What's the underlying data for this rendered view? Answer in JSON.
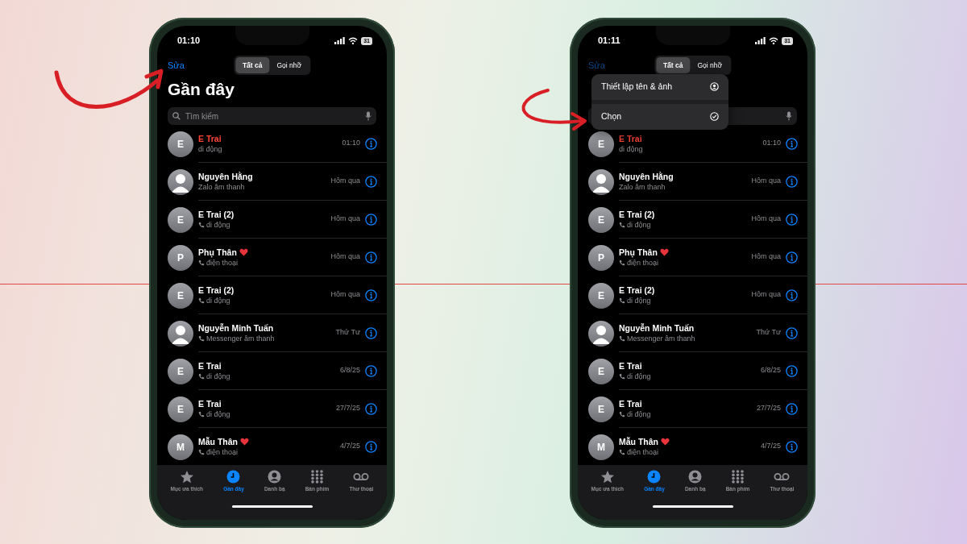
{
  "phones": [
    {
      "status_time": "01:10",
      "battery": "31",
      "edit_label": "Sửa",
      "edit_dimmed": false,
      "segments": [
        {
          "label": "Tất cả",
          "selected": true
        },
        {
          "label": "Gọi nhỡ",
          "selected": false
        }
      ],
      "title": "Gần đây",
      "search_placeholder": "Tìm kiếm",
      "calls": [
        {
          "name": "E Trai",
          "missed": true,
          "kind": "letter",
          "initial": "E",
          "favorite": false,
          "phone_icon": false,
          "detail": "di động",
          "time": "01:10"
        },
        {
          "name": "Nguyên Hằng",
          "missed": false,
          "kind": "silhouette",
          "favorite": false,
          "phone_icon": false,
          "detail": "Zalo âm thanh",
          "time": "Hôm qua"
        },
        {
          "name": "E Trai (2)",
          "missed": false,
          "kind": "letter",
          "initial": "E",
          "favorite": false,
          "phone_icon": true,
          "detail": "di động",
          "time": "Hôm qua"
        },
        {
          "name": "Phụ Thân",
          "missed": false,
          "kind": "letter",
          "initial": "P",
          "favorite": true,
          "phone_icon": true,
          "detail": "điện thoại",
          "time": "Hôm qua"
        },
        {
          "name": "E Trai (2)",
          "missed": false,
          "kind": "letter",
          "initial": "E",
          "favorite": false,
          "phone_icon": true,
          "detail": "di động",
          "time": "Hôm qua"
        },
        {
          "name": "Nguyễn Minh Tuấn",
          "missed": false,
          "kind": "silhouette",
          "favorite": false,
          "phone_icon": true,
          "detail": "Messenger âm thanh",
          "time": "Thứ Tư"
        },
        {
          "name": "E Trai",
          "missed": false,
          "kind": "letter",
          "initial": "E",
          "favorite": false,
          "phone_icon": true,
          "detail": "di động",
          "time": "6/8/25"
        },
        {
          "name": "E Trai",
          "missed": false,
          "kind": "letter",
          "initial": "E",
          "favorite": false,
          "phone_icon": true,
          "detail": "di động",
          "time": "27/7/25"
        },
        {
          "name": "Mẫu Thân",
          "missed": false,
          "kind": "letter",
          "initial": "M",
          "favorite": true,
          "phone_icon": true,
          "detail": "điện thoại",
          "time": "4/7/25"
        }
      ],
      "tabs": [
        {
          "label": "Mục ưa thích",
          "kind": "star",
          "selected": false
        },
        {
          "label": "Gần đây",
          "kind": "clock",
          "selected": true
        },
        {
          "label": "Danh bạ",
          "kind": "person",
          "selected": false
        },
        {
          "label": "Bàn phím",
          "kind": "keypad",
          "selected": false
        },
        {
          "label": "Thư thoại",
          "kind": "voicemail",
          "selected": false
        }
      ]
    },
    {
      "status_time": "01:11",
      "battery": "31",
      "edit_label": "Sửa",
      "edit_dimmed": true,
      "segments": [
        {
          "label": "Tất cả",
          "selected": true
        },
        {
          "label": "Gọi nhỡ",
          "selected": false
        }
      ],
      "menu": [
        {
          "label": "Thiết lập tên & ảnh",
          "kind": "profile"
        },
        {
          "label": "Chọn",
          "kind": "check"
        }
      ],
      "calls": [
        {
          "name": "E Trai",
          "missed": true,
          "kind": "letter",
          "initial": "E",
          "favorite": false,
          "phone_icon": false,
          "detail": "di động",
          "time": "01:10"
        },
        {
          "name": "Nguyên Hằng",
          "missed": false,
          "kind": "silhouette",
          "favorite": false,
          "phone_icon": false,
          "detail": "Zalo âm thanh",
          "time": "Hôm qua"
        },
        {
          "name": "E Trai (2)",
          "missed": false,
          "kind": "letter",
          "initial": "E",
          "favorite": false,
          "phone_icon": true,
          "detail": "di động",
          "time": "Hôm qua"
        },
        {
          "name": "Phụ Thân",
          "missed": false,
          "kind": "letter",
          "initial": "P",
          "favorite": true,
          "phone_icon": true,
          "detail": "điện thoại",
          "time": "Hôm qua"
        },
        {
          "name": "E Trai (2)",
          "missed": false,
          "kind": "letter",
          "initial": "E",
          "favorite": false,
          "phone_icon": true,
          "detail": "di động",
          "time": "Hôm qua"
        },
        {
          "name": "Nguyễn Minh Tuấn",
          "missed": false,
          "kind": "silhouette",
          "favorite": false,
          "phone_icon": true,
          "detail": "Messenger âm thanh",
          "time": "Thứ Tư"
        },
        {
          "name": "E Trai",
          "missed": false,
          "kind": "letter",
          "initial": "E",
          "favorite": false,
          "phone_icon": true,
          "detail": "di động",
          "time": "6/8/25"
        },
        {
          "name": "E Trai",
          "missed": false,
          "kind": "letter",
          "initial": "E",
          "favorite": false,
          "phone_icon": true,
          "detail": "di động",
          "time": "27/7/25"
        },
        {
          "name": "Mẫu Thân",
          "missed": false,
          "kind": "letter",
          "initial": "M",
          "favorite": true,
          "phone_icon": true,
          "detail": "điện thoại",
          "time": "4/7/25"
        }
      ],
      "tabs": [
        {
          "label": "Mục ưa thích",
          "kind": "star",
          "selected": false
        },
        {
          "label": "Gần đây",
          "kind": "clock",
          "selected": true
        },
        {
          "label": "Danh bạ",
          "kind": "person",
          "selected": false
        },
        {
          "label": "Bàn phím",
          "kind": "keypad",
          "selected": false
        },
        {
          "label": "Thư thoại",
          "kind": "voicemail",
          "selected": false
        }
      ]
    }
  ]
}
